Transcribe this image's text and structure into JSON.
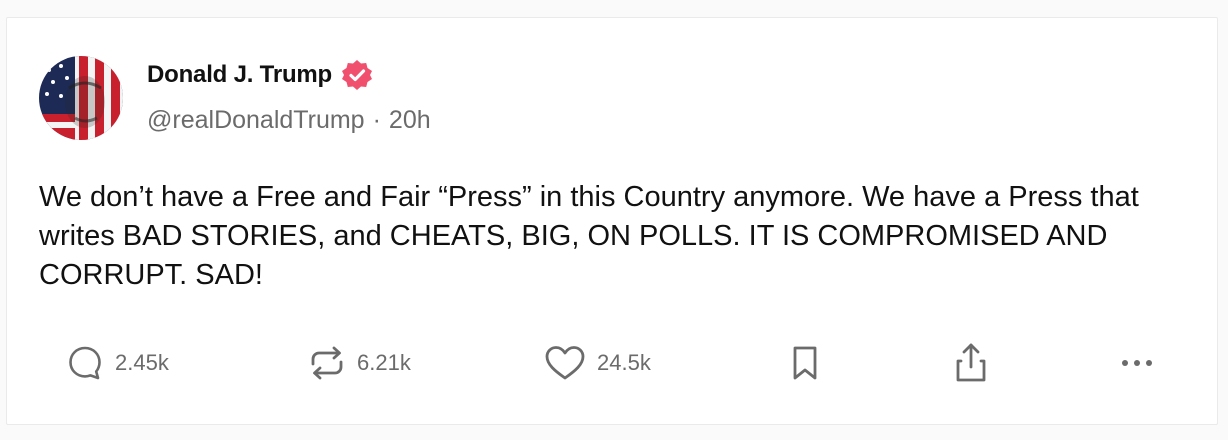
{
  "post": {
    "author": {
      "display_name": "Donald J. Trump",
      "handle": "@realDonaldTrump",
      "verified": true,
      "avatar": "avatar-flag-portrait"
    },
    "separator": "·",
    "time_ago": "20h",
    "text": "We don’t have a Free and Fair “Press” in this Country anymore. We have a Press that writes BAD STORIES, and CHEATS, BIG, ON POLLS. IT IS COMPROMISED AND CORRUPT. SAD!",
    "actions": {
      "reply": {
        "icon": "comment-icon",
        "count": "2.45k"
      },
      "repost": {
        "icon": "repost-icon",
        "count": "6.21k"
      },
      "like": {
        "icon": "heart-icon",
        "count": "24.5k"
      },
      "bookmark": {
        "icon": "bookmark-icon"
      },
      "share": {
        "icon": "share-icon"
      },
      "more": {
        "icon": "more-icon"
      }
    }
  },
  "colors": {
    "verified_badge": "#f0506e",
    "text_primary": "#111111",
    "text_secondary": "#6b6b6b",
    "background": "#fafafa",
    "card": "#ffffff"
  }
}
